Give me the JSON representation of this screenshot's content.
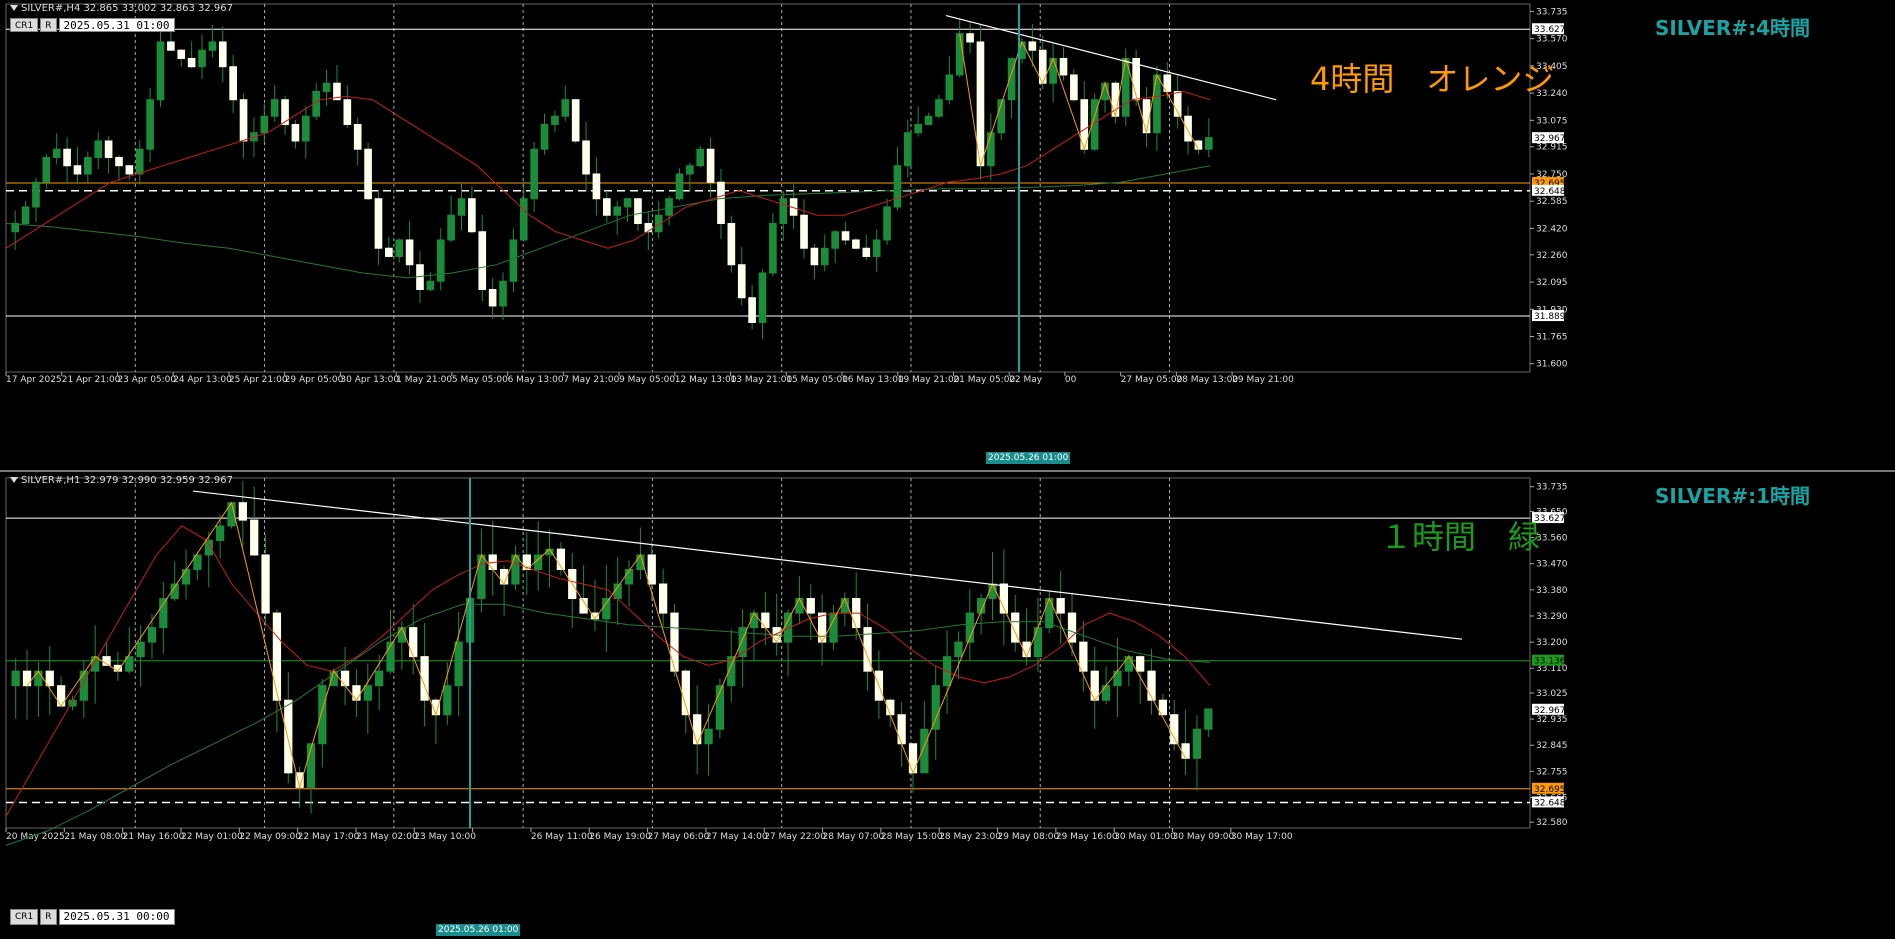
{
  "chart_data": [
    {
      "type": "candlestick",
      "symbol_line": "SILVER#,H4  32.865 33.002 32.863 32.967",
      "title": "SILVER#:4時間",
      "annotation": "4時間　オレンジ",
      "annotation_color": "#ff9900",
      "toolbar": {
        "btn1": "CR1",
        "btn2": "R",
        "datetime": "2025.05.31 01:00"
      },
      "cursor_time_label": "2025.05.26 01:00",
      "ylim": [
        31.55,
        33.78
      ],
      "y_ticks": [
        "33.735",
        "33.570",
        "33.405",
        "33.240",
        "33.075",
        "32.915",
        "32.750",
        "32.585",
        "32.420",
        "32.260",
        "32.095",
        "31.930",
        "31.765",
        "31.600"
      ],
      "x_ticks": [
        "17 Apr 2025",
        "21 Apr 21:00",
        "23 Apr 05:00",
        "24 Apr 13:00",
        "25 Apr 21:00",
        "29 Apr 05:00",
        "30 Apr 13:00",
        "1 May 21:00",
        "5 May 05:00",
        "6 May 13:00",
        "7 May 21:00",
        "9 May 05:00",
        "12 May 13:00",
        "13 May 21:00",
        "15 May 05:00",
        "16 May 13:00",
        "19 May 21:00",
        "21 May 05:00",
        "22 May",
        "00",
        "27 May 05:00",
        "28 May 13:00",
        "29 May 21:00"
      ],
      "price_tags": [
        {
          "label": "33.627",
          "value": 33.627,
          "bg": "#ffffff",
          "fg": "#000000"
        },
        {
          "label": "32.967",
          "value": 32.967,
          "bg": "#ffffff",
          "fg": "#000000"
        },
        {
          "label": "32.695",
          "value": 32.695,
          "bg": "#ff9900",
          "fg": "#000000"
        },
        {
          "label": "32.648",
          "value": 32.648,
          "bg": "#ffffff",
          "fg": "#000000"
        },
        {
          "label": "31.889",
          "value": 31.889,
          "bg": "#ffffff",
          "fg": "#000000"
        }
      ],
      "levels": [
        {
          "name": "resistance-line",
          "value": 33.627,
          "color": "#ffffff",
          "dash": false
        },
        {
          "name": "support-line",
          "value": 31.889,
          "color": "#ffffff",
          "dash": false
        },
        {
          "name": "orange-level",
          "value": 32.695,
          "color": "#ff9900",
          "dash": false
        },
        {
          "name": "dashed-level",
          "value": 32.648,
          "color": "#ffffff",
          "dash": true
        }
      ],
      "seed": 11,
      "closes": [
        32.45,
        32.55,
        32.7,
        32.85,
        32.9,
        32.8,
        32.75,
        32.85,
        32.95,
        32.85,
        32.8,
        32.75,
        32.9,
        33.2,
        33.55,
        33.5,
        33.45,
        33.4,
        33.5,
        33.55,
        33.4,
        33.2,
        32.95,
        33.0,
        33.1,
        33.2,
        33.05,
        32.95,
        33.1,
        33.25,
        33.3,
        33.2,
        33.05,
        32.9,
        32.6,
        32.3,
        32.25,
        32.35,
        32.2,
        32.05,
        32.1,
        32.35,
        32.5,
        32.6,
        32.4,
        32.05,
        31.95,
        32.1,
        32.35,
        32.6,
        32.9,
        33.05,
        33.1,
        33.2,
        32.95,
        32.75,
        32.6,
        32.5,
        32.55,
        32.6,
        32.45,
        32.4,
        32.5,
        32.6,
        32.75,
        32.8,
        32.9,
        32.7,
        32.45,
        32.2,
        32.0,
        31.85,
        32.15,
        32.45,
        32.6,
        32.5,
        32.3,
        32.2,
        32.3,
        32.4,
        32.35,
        32.3,
        32.25,
        32.35,
        32.55,
        32.8,
        33.0,
        33.05,
        33.1,
        33.2,
        33.35,
        33.6,
        33.55,
        32.8,
        33.0,
        33.2,
        33.45,
        33.55,
        33.5,
        33.3,
        33.45,
        33.35,
        33.2,
        32.9,
        33.2,
        33.3,
        33.1,
        33.45,
        33.2,
        33.0,
        33.35,
        33.25,
        33.1,
        32.95,
        32.9,
        32.97
      ],
      "ema_red": [
        32.3,
        32.4,
        32.5,
        32.6,
        32.7,
        32.75,
        32.8,
        32.85,
        32.9,
        32.95,
        33.0,
        33.1,
        33.2,
        33.22,
        33.2,
        33.1,
        33.0,
        32.9,
        32.8,
        32.65,
        32.5,
        32.4,
        32.35,
        32.3,
        32.35,
        32.45,
        32.55,
        32.6,
        32.65,
        32.6,
        32.55,
        32.5,
        32.5,
        32.55,
        32.6,
        32.65,
        32.7,
        32.72,
        32.75,
        32.8,
        32.9,
        33.0,
        33.1,
        33.2,
        33.22,
        33.25,
        33.2
      ],
      "sma_green": [
        32.45,
        32.43,
        32.4,
        32.37,
        32.33,
        32.3,
        32.25,
        32.2,
        32.15,
        32.12,
        32.15,
        32.2,
        32.3,
        32.4,
        32.5,
        32.55,
        32.6,
        32.62,
        32.63,
        32.64,
        32.65,
        32.66,
        32.66,
        32.67,
        32.68,
        32.7,
        32.75,
        32.8
      ]
    },
    {
      "type": "candlestick",
      "symbol_line": "SILVER#,H1  32.979 32.990 32.959 32.967",
      "title": "SILVER#:1時間",
      "annotation": "１時間　緑",
      "annotation_color": "#1a9c1a",
      "toolbar": {
        "btn1": "CR1",
        "btn2": "R",
        "datetime": "2025.05.31 00:00"
      },
      "cursor_time_label": "2025.05.26 01:00",
      "ylim": [
        32.56,
        33.765
      ],
      "y_ticks": [
        "33.735",
        "33.650",
        "33.560",
        "33.470",
        "33.380",
        "33.290",
        "33.200",
        "33.110",
        "33.025",
        "32.935",
        "32.845",
        "32.755",
        "32.665",
        "32.580"
      ],
      "x_ticks": [
        "20 May 2025",
        "21 May 08:00",
        "21 May 16:00",
        "22 May 01:00",
        "22 May 09:00",
        "22 May 17:00",
        "23 May 02:00",
        "23 May 10:00",
        "",
        "26 May 11:00",
        "26 May 19:00",
        "27 May 06:00",
        "27 May 14:00",
        "27 May 22:00",
        "28 May 07:00",
        "28 May 15:00",
        "28 May 23:00",
        "29 May 08:00",
        "29 May 16:00",
        "30 May 01:00",
        "30 May 09:00",
        "30 May 17:00"
      ],
      "price_tags": [
        {
          "label": "33.627",
          "value": 33.627,
          "bg": "#ffffff",
          "fg": "#000000"
        },
        {
          "label": "33.136",
          "value": 33.136,
          "bg": "#1a9c1a",
          "fg": "#000000"
        },
        {
          "label": "32.967",
          "value": 32.967,
          "bg": "#ffffff",
          "fg": "#000000"
        },
        {
          "label": "32.695",
          "value": 32.695,
          "bg": "#ff9900",
          "fg": "#000000"
        },
        {
          "label": "32.648",
          "value": 32.648,
          "bg": "#ffffff",
          "fg": "#000000"
        }
      ],
      "levels": [
        {
          "name": "resistance-line",
          "value": 33.627,
          "color": "#ffffff",
          "dash": false
        },
        {
          "name": "green-level",
          "value": 33.136,
          "color": "#1a9c1a",
          "dash": false
        },
        {
          "name": "orange-level",
          "value": 32.695,
          "color": "#ff9900",
          "dash": false
        },
        {
          "name": "dashed-level",
          "value": 32.648,
          "color": "#ffffff",
          "dash": true
        }
      ],
      "seed": 29,
      "closes": [
        33.1,
        33.05,
        33.1,
        33.05,
        32.98,
        33.0,
        33.1,
        33.15,
        33.12,
        33.1,
        33.15,
        33.2,
        33.25,
        33.35,
        33.4,
        33.45,
        33.5,
        33.55,
        33.6,
        33.68,
        33.62,
        33.5,
        33.3,
        33.0,
        32.75,
        32.7,
        32.85,
        33.05,
        33.1,
        33.05,
        33.0,
        33.05,
        33.1,
        33.2,
        33.25,
        33.15,
        33.0,
        32.95,
        33.05,
        33.2,
        33.35,
        33.5,
        33.45,
        33.4,
        33.5,
        33.45,
        33.5,
        33.52,
        33.45,
        33.35,
        33.3,
        33.28,
        33.35,
        33.4,
        33.45,
        33.5,
        33.4,
        33.3,
        33.1,
        32.95,
        32.85,
        32.9,
        33.05,
        33.15,
        33.25,
        33.3,
        33.25,
        33.2,
        33.3,
        33.35,
        33.3,
        33.2,
        33.3,
        33.35,
        33.25,
        33.1,
        33.0,
        32.95,
        32.85,
        32.75,
        32.9,
        33.05,
        33.15,
        33.2,
        33.3,
        33.35,
        33.4,
        33.3,
        33.2,
        33.15,
        33.25,
        33.35,
        33.3,
        33.2,
        33.1,
        33.0,
        33.05,
        33.1,
        33.15,
        33.1,
        33.0,
        32.95,
        32.85,
        32.8,
        32.9,
        32.97
      ],
      "ema_red": [
        32.6,
        32.75,
        32.9,
        33.05,
        33.2,
        33.35,
        33.5,
        33.6,
        33.55,
        33.4,
        33.3,
        33.2,
        33.12,
        33.1,
        33.15,
        33.22,
        33.3,
        33.38,
        33.43,
        33.47,
        33.48,
        33.45,
        33.42,
        33.4,
        33.38,
        33.3,
        33.22,
        33.15,
        33.12,
        33.14,
        33.2,
        33.24,
        33.28,
        33.3,
        33.3,
        33.25,
        33.18,
        33.12,
        33.08,
        33.06,
        33.08,
        33.12,
        33.18,
        33.26,
        33.3,
        33.27,
        33.22,
        33.15,
        33.05
      ],
      "sma_green": [
        32.5,
        32.55,
        32.62,
        32.7,
        32.78,
        32.85,
        32.92,
        33.0,
        33.1,
        33.2,
        33.28,
        33.33,
        33.33,
        33.3,
        33.28,
        33.26,
        33.25,
        33.24,
        33.23,
        33.22,
        33.22,
        33.23,
        33.24,
        33.26,
        33.27,
        33.27,
        33.22,
        33.17,
        33.14,
        33.13
      ]
    }
  ]
}
